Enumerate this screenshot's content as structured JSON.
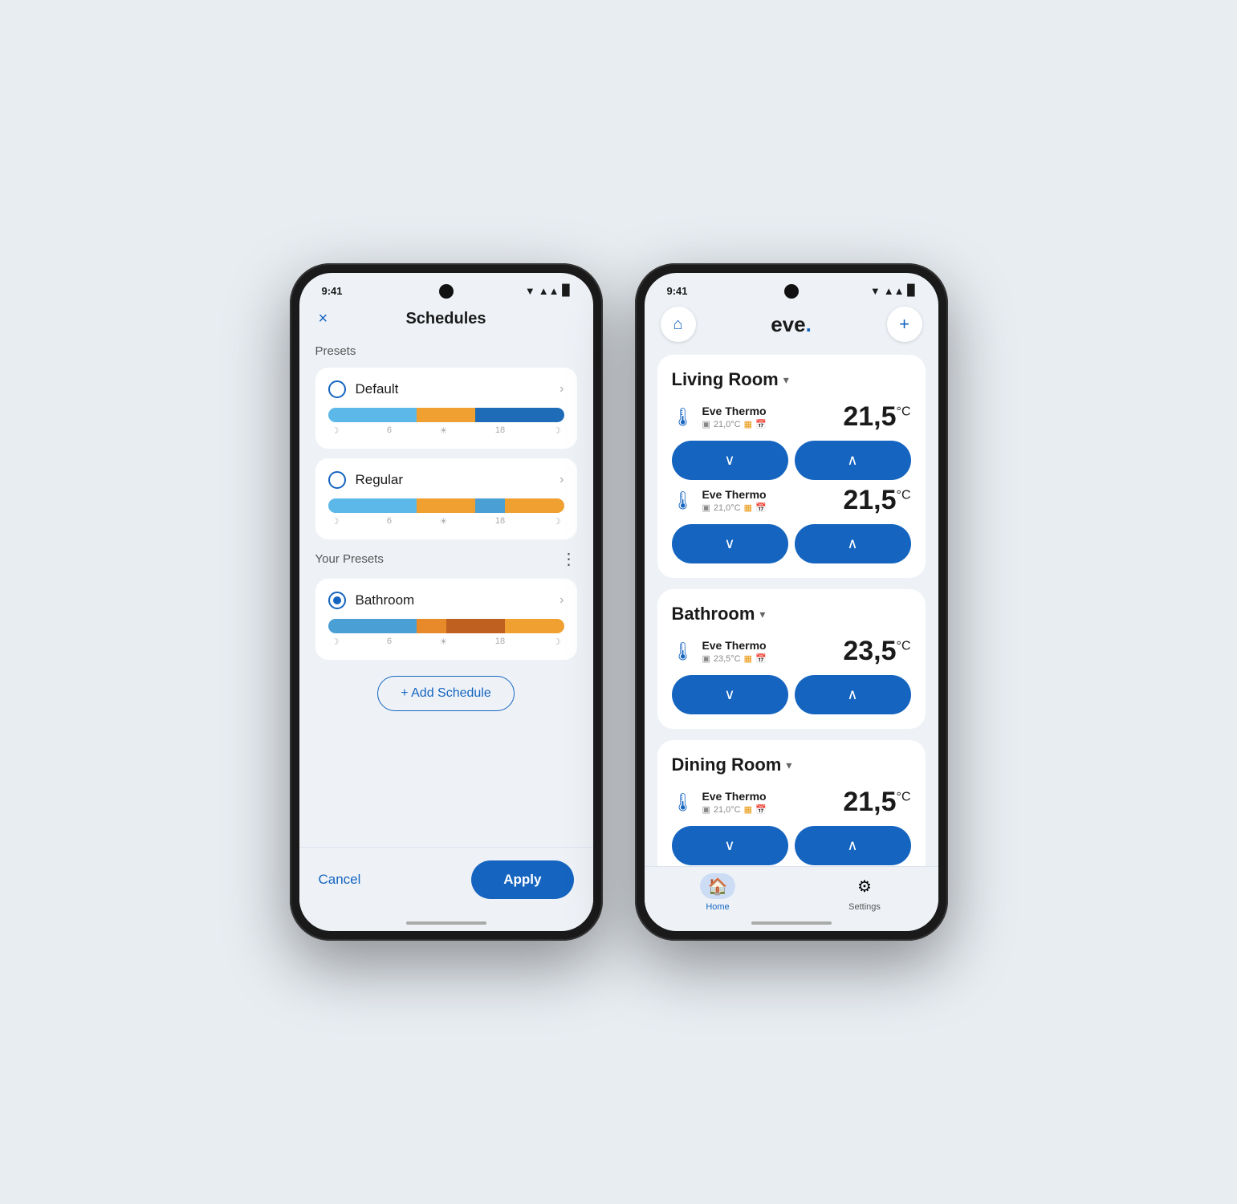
{
  "phone1": {
    "status": {
      "time": "9:41",
      "signal": "▲",
      "battery": "🔋"
    },
    "title": "Schedules",
    "close_label": "×",
    "presets_label": "Presets",
    "your_presets_label": "Your Presets",
    "presets": [
      {
        "id": "default",
        "name": "Default",
        "selected": false,
        "bar": [
          {
            "color": "seg-blue-light",
            "flex": 3
          },
          {
            "color": "seg-orange",
            "flex": 2
          },
          {
            "color": "seg-blue",
            "flex": 3
          }
        ],
        "labels": [
          "☽",
          "6",
          "☀",
          "18",
          "☽"
        ]
      },
      {
        "id": "regular",
        "name": "Regular",
        "selected": false,
        "bar": [
          {
            "color": "seg-blue-light",
            "flex": 3
          },
          {
            "color": "seg-orange",
            "flex": 2
          },
          {
            "color": "seg-blue2",
            "flex": 1
          },
          {
            "color": "seg-orange2",
            "flex": 2
          }
        ],
        "labels": [
          "☽",
          "6",
          "☀",
          "18",
          "☽"
        ]
      }
    ],
    "user_presets": [
      {
        "id": "bathroom",
        "name": "Bathroom",
        "selected": true,
        "bar": [
          {
            "color": "seg-bath-blue",
            "flex": 3
          },
          {
            "color": "seg-bath-orange",
            "flex": 1
          },
          {
            "color": "seg-bath-brown",
            "flex": 2
          },
          {
            "color": "seg-bath-orange2",
            "flex": 2
          }
        ],
        "labels": [
          "☽",
          "6",
          "☀",
          "18",
          "☽"
        ]
      }
    ],
    "add_schedule_label": "+ Add Schedule",
    "cancel_label": "Cancel",
    "apply_label": "Apply"
  },
  "phone2": {
    "status": {
      "time": "9:41"
    },
    "logo": "eve.",
    "rooms": [
      {
        "name": "Living Room",
        "devices": [
          {
            "name": "Eve Thermo",
            "sub_temp": "21,0°C",
            "temp": "21,5",
            "unit": "°C"
          },
          {
            "name": "Eve Thermo",
            "sub_temp": "21,0°C",
            "temp": "21,5",
            "unit": "°C"
          }
        ]
      },
      {
        "name": "Bathroom",
        "devices": [
          {
            "name": "Eve Thermo",
            "sub_temp": "23,5°C",
            "temp": "23,5",
            "unit": "°C"
          }
        ]
      },
      {
        "name": "Dining Room",
        "devices": [
          {
            "name": "Eve Thermo",
            "sub_temp": "21,0°C",
            "temp": "21,5",
            "unit": "°C"
          }
        ]
      }
    ],
    "tabs": [
      {
        "id": "home",
        "label": "Home",
        "active": true,
        "icon": "🏠"
      },
      {
        "id": "settings",
        "label": "Settings",
        "active": false,
        "icon": "⚙"
      }
    ]
  }
}
